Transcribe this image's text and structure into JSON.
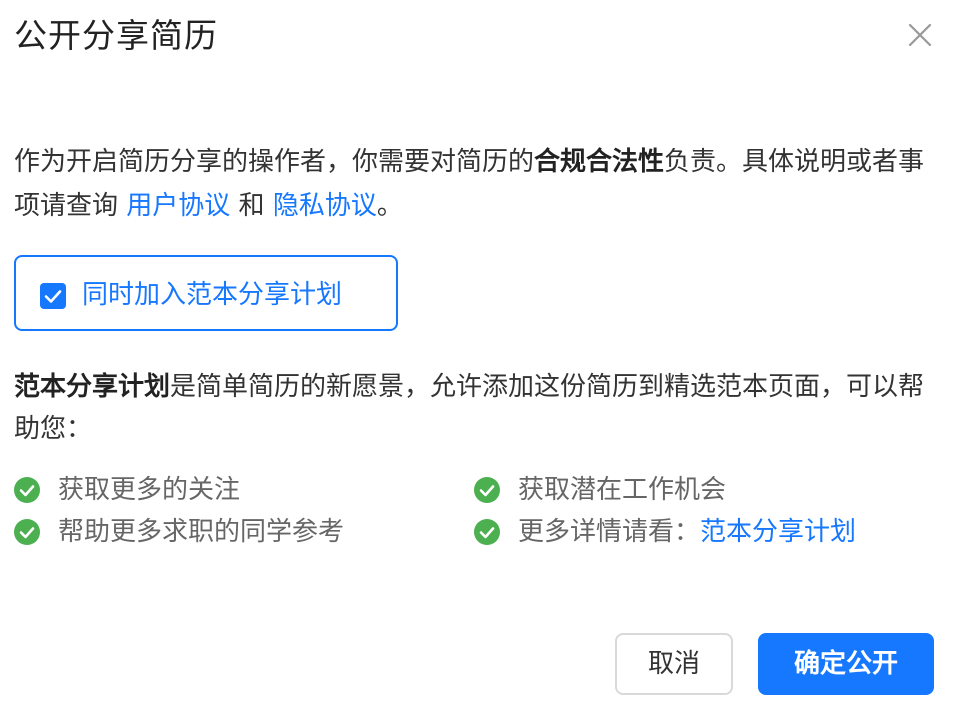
{
  "dialog": {
    "title": "公开分享简历",
    "close_icon": "close-icon"
  },
  "description": {
    "part1": "作为开启简历分享的操作者，你需要对简历的",
    "bold": "合规合法性",
    "part2": "负责。具体说明或者事项请查询 ",
    "user_agreement": "用户协议",
    "conj": " 和 ",
    "privacy_agreement": "隐私协议",
    "end": "。"
  },
  "template_checkbox": {
    "checked": true,
    "label": "同时加入范本分享计划"
  },
  "plan_description": {
    "bold": "范本分享计划",
    "text": "是简单简历的新愿景，允许添加这份简历到精选范本页面，可以帮助您："
  },
  "benefits": [
    {
      "text": "获取更多的关注",
      "icon": "check-circle-icon"
    },
    {
      "text": "获取潜在工作机会",
      "icon": "check-circle-icon"
    },
    {
      "text": "帮助更多求职的同学参考",
      "icon": "check-circle-icon"
    },
    {
      "text": "更多详情请看：",
      "link": "范本分享计划",
      "icon": "check-circle-icon"
    }
  ],
  "buttons": {
    "cancel": "取消",
    "confirm": "确定公开"
  },
  "colors": {
    "accent": "#1677ff",
    "success": "#4caf50",
    "text": "#333333",
    "muted": "#666666"
  }
}
